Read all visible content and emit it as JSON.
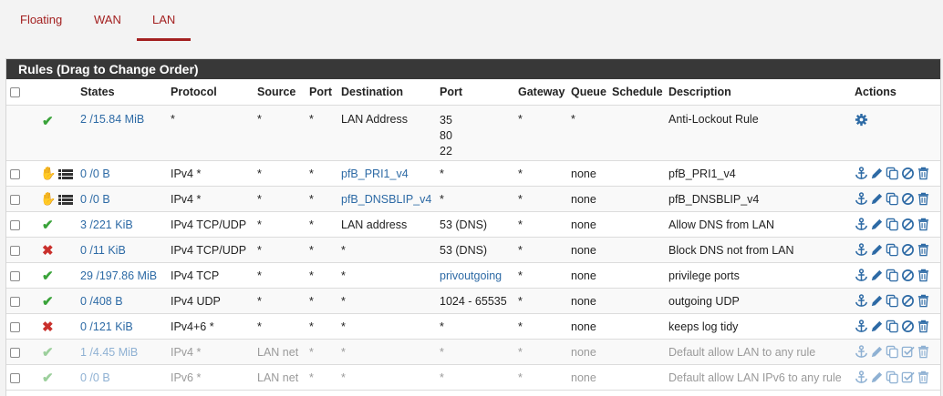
{
  "tabs": [
    {
      "label": "Floating"
    },
    {
      "label": "WAN"
    },
    {
      "label": "LAN",
      "active": true
    }
  ],
  "panel": {
    "title": "Rules (Drag to Change Order)"
  },
  "columns": {
    "states": "States",
    "protocol": "Protocol",
    "source": "Source",
    "port": "Port",
    "destination": "Destination",
    "dport": "Port",
    "gateway": "Gateway",
    "queue": "Queue",
    "schedule": "Schedule",
    "description": "Description",
    "actions": "Actions"
  },
  "colors": {
    "accent": "#a32020",
    "link": "#2d6aa5",
    "pass": "#3aa33a",
    "block": "#c9302c",
    "heading": "#383838"
  },
  "rules": [
    {
      "status": "pass",
      "states": "2 /15.84 MiB",
      "protocol": "*",
      "source": "*",
      "port": "*",
      "destination": "LAN Address",
      "dport_lines": [
        "35",
        "80",
        "22"
      ],
      "gateway": "*",
      "queue": "*",
      "schedule": "",
      "description": "Anti-Lockout Rule"
    },
    {
      "status": "pfb",
      "states": "0 /0 B",
      "protocol": "IPv4 *",
      "source": "*",
      "port": "*",
      "destination": "pfB_PRI1_v4",
      "dest_link": true,
      "dport": "*",
      "gateway": "*",
      "queue": "none",
      "schedule": "",
      "description": "pfB_PRI1_v4"
    },
    {
      "status": "pfb",
      "states": "0 /0 B",
      "protocol": "IPv4 *",
      "source": "*",
      "port": "*",
      "destination": "pfB_DNSBLIP_v4",
      "dest_link": true,
      "dport": "*",
      "gateway": "*",
      "queue": "none",
      "schedule": "",
      "description": "pfB_DNSBLIP_v4"
    },
    {
      "status": "pass",
      "states": "3 /221 KiB",
      "protocol": "IPv4 TCP/UDP",
      "source": "*",
      "port": "*",
      "destination": "LAN address",
      "dport": "53 (DNS)",
      "gateway": "*",
      "queue": "none",
      "schedule": "",
      "description": "Allow DNS from LAN"
    },
    {
      "status": "block",
      "states": "0 /11 KiB",
      "protocol": "IPv4 TCP/UDP",
      "source": "*",
      "port": "*",
      "destination": "*",
      "dport": "53 (DNS)",
      "gateway": "*",
      "queue": "none",
      "schedule": "",
      "description": "Block DNS not from LAN"
    },
    {
      "status": "pass",
      "states": "29 /197.86 MiB",
      "protocol": "IPv4 TCP",
      "source": "*",
      "port": "*",
      "destination": "*",
      "dport": "privoutgoing",
      "dport_link": true,
      "gateway": "*",
      "queue": "none",
      "schedule": "",
      "description": "privilege ports"
    },
    {
      "status": "pass",
      "states": "0 /408 B",
      "protocol": "IPv4 UDP",
      "source": "*",
      "port": "*",
      "destination": "*",
      "dport": "1024 - 65535",
      "gateway": "*",
      "queue": "none",
      "schedule": "",
      "description": "outgoing UDP"
    },
    {
      "status": "block",
      "states": "0 /121 KiB",
      "protocol": "IPv4+6 *",
      "source": "*",
      "port": "*",
      "destination": "*",
      "dport": "*",
      "gateway": "*",
      "queue": "none",
      "schedule": "",
      "description": "keeps log tidy"
    },
    {
      "status": "pass",
      "disabled": true,
      "states": "1 /4.45 MiB",
      "protocol": "IPv4 *",
      "source": "LAN net",
      "port": "*",
      "destination": "*",
      "dport": "*",
      "gateway": "*",
      "queue": "none",
      "schedule": "",
      "description": "Default allow LAN to any rule"
    },
    {
      "status": "pass",
      "disabled": true,
      "states": "0 /0 B",
      "protocol": "IPv6 *",
      "source": "LAN net",
      "port": "*",
      "destination": "*",
      "dport": "*",
      "gateway": "*",
      "queue": "none",
      "schedule": "",
      "description": "Default allow LAN IPv6 to any rule"
    }
  ]
}
